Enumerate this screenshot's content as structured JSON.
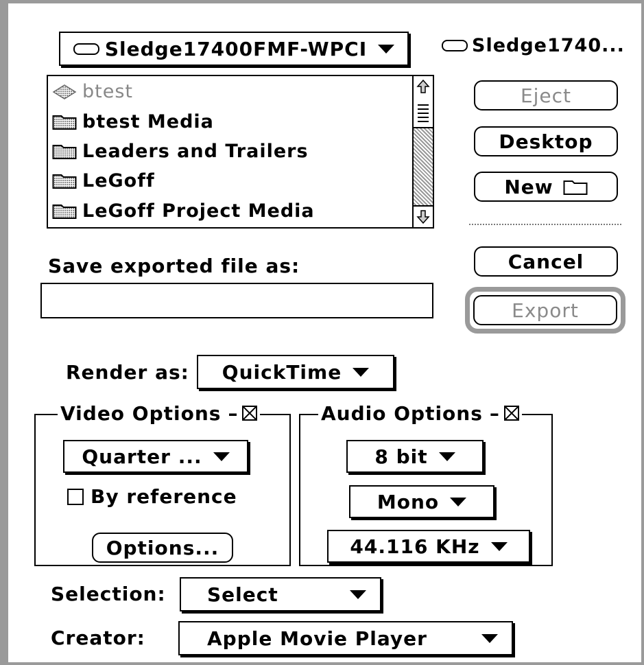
{
  "volume_popup": {
    "label": "Sledge17400FMF-WPCI"
  },
  "volume_name": "Sledge1740...",
  "file_list": [
    {
      "name": "btest",
      "kind": "document",
      "enabled": false
    },
    {
      "name": "btest Media",
      "kind": "folder",
      "enabled": true
    },
    {
      "name": "Leaders and Trailers",
      "kind": "folder",
      "enabled": true
    },
    {
      "name": "LeGoff",
      "kind": "folder",
      "enabled": true
    },
    {
      "name": "LeGoff Project Media",
      "kind": "folder",
      "enabled": true
    }
  ],
  "buttons": {
    "eject": "Eject",
    "desktop": "Desktop",
    "new": "New",
    "cancel": "Cancel",
    "export": "Export",
    "options": "Options..."
  },
  "save_label": "Save exported file as:",
  "filename": {
    "value": ""
  },
  "render_as": {
    "label": "Render as:",
    "value": "QuickTime"
  },
  "video_options": {
    "title": "Video Options",
    "enabled": true,
    "size": "Quarter ...",
    "by_reference_label": "By reference",
    "by_reference_checked": false
  },
  "audio_options": {
    "title": "Audio Options",
    "enabled": true,
    "bits": "8 bit",
    "channels": "Mono",
    "rate": "44.116 KHz"
  },
  "selection": {
    "label": "Selection:",
    "value": "Select"
  },
  "creator": {
    "label": "Creator:",
    "value": "Apple Movie Player"
  }
}
